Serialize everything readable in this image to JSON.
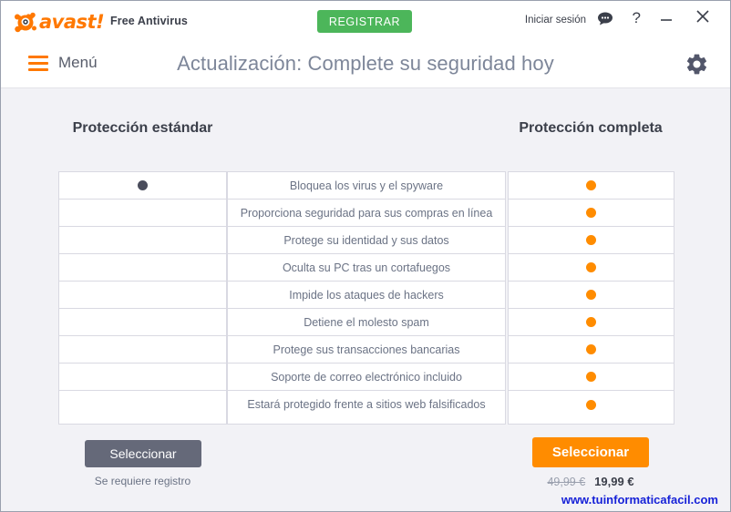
{
  "header": {
    "logo_text": "avast!",
    "logo_icon": "avast-ball-icon",
    "product_name": "Free Antivirus",
    "register_label": "REGISTRAR",
    "login_label": "Iniciar sesión",
    "chat_icon": "speech-bubble-icon",
    "help_icon": "question-mark-icon",
    "minimize_icon": "minimize-icon",
    "close_icon": "close-icon",
    "menu_label": "Menú",
    "menu_icon": "hamburger-icon",
    "page_title": "Actualización: Complete su seguridad hoy",
    "settings_icon": "gear-icon"
  },
  "colors": {
    "brand_orange": "#ff7800",
    "dot_orange": "#ff8c00",
    "register_green": "#4cb65a",
    "free_button_gray": "#656979",
    "title_gray": "#7d8699",
    "watermark_blue": "#1722d8",
    "body_background": "#f2f2f6"
  },
  "comparison": {
    "left_column_heading": "Protección estándar",
    "right_column_heading": "Protección completa",
    "rows": [
      {
        "feature": "Bloquea los virus y el spyware",
        "standard": "dark-dot",
        "complete": "orange-dot"
      },
      {
        "feature": "Proporciona seguridad para sus compras en línea",
        "standard": "none",
        "complete": "orange-dot"
      },
      {
        "feature": "Protege su identidad y sus datos",
        "standard": "none",
        "complete": "orange-dot"
      },
      {
        "feature": "Oculta su PC tras un cortafuegos",
        "standard": "none",
        "complete": "orange-dot"
      },
      {
        "feature": "Impide los ataques de hackers",
        "standard": "none",
        "complete": "orange-dot"
      },
      {
        "feature": "Detiene el molesto spam",
        "standard": "none",
        "complete": "orange-dot"
      },
      {
        "feature": "Protege sus transacciones bancarias",
        "standard": "none",
        "complete": "orange-dot"
      },
      {
        "feature": "Soporte de correo electrónico incluido",
        "standard": "none",
        "complete": "orange-dot"
      },
      {
        "feature": "Estará protegido frente a sitios web falsificados",
        "standard": "none",
        "complete": "orange-dot"
      }
    ]
  },
  "footer": {
    "free_select_label": "Seleccionar",
    "free_note": "Se requiere registro",
    "pro_select_label": "Seleccionar",
    "price_old": "49,99 €",
    "price_new": "19,99 €",
    "watermark": "www.tuinformaticafacil.com"
  }
}
